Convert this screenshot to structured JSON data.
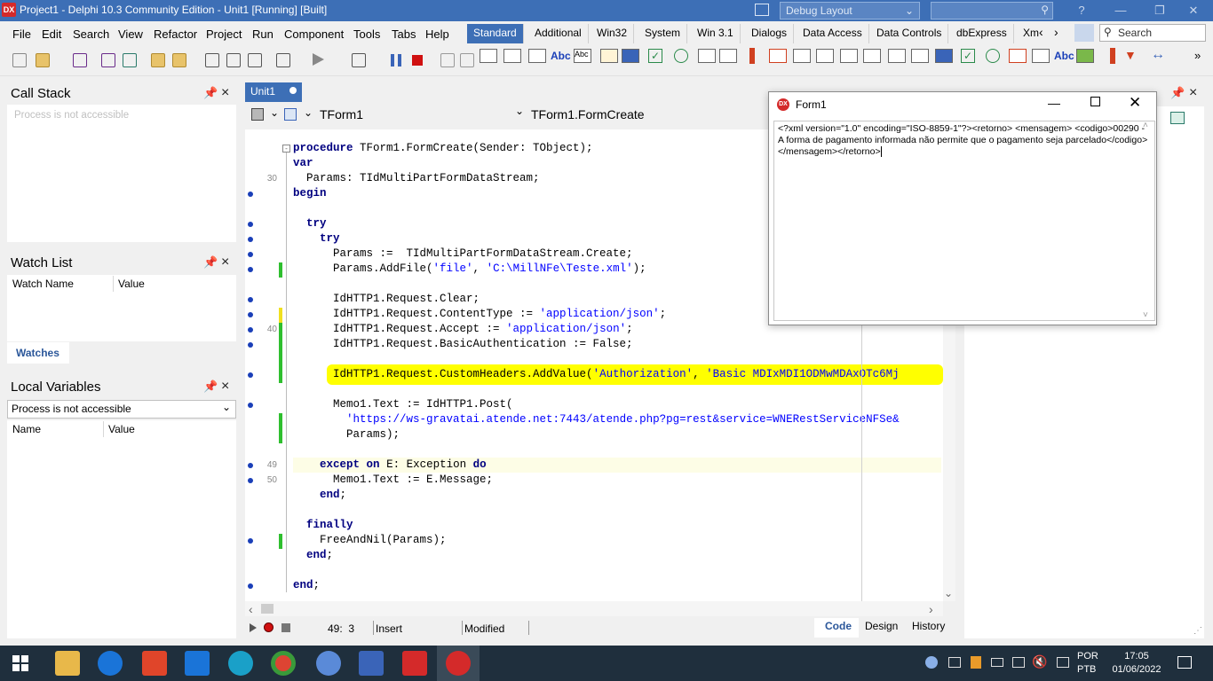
{
  "titlebar": {
    "logo": "DX",
    "title": "Project1 - Delphi 10.3 Community Edition - Unit1 [Running] [Built]",
    "layout_value": "Debug Layout"
  },
  "menu": [
    "File",
    "Edit",
    "Search",
    "View",
    "Refactor",
    "Project",
    "Run",
    "Component",
    "Tools",
    "Tabs",
    "Help"
  ],
  "palette_tabs": [
    "Standard",
    "Additional",
    "Win32",
    "System",
    "Win 3.1",
    "Dialogs",
    "Data Access",
    "Data Controls",
    "dbExpress",
    "Xm"
  ],
  "palette_search_placeholder": "Search",
  "call_stack": {
    "title": "Call Stack",
    "status": "Process is not accessible"
  },
  "watch_list": {
    "title": "Watch List",
    "col_name": "Watch Name",
    "col_value": "Value",
    "tab": "Watches"
  },
  "local_vars": {
    "title": "Local Variables",
    "combo": "Process is not accessible",
    "col_name": "Name",
    "col_value": "Value"
  },
  "editor": {
    "tab": "Unit1",
    "class_combo": "TForm1",
    "method_combo": "TForm1.FormCreate",
    "lines": [
      {
        "t": "procedure TForm1.FormCreate(Sender: TObject);",
        "ln": "",
        "bp": false
      },
      {
        "t": "var",
        "ln": "",
        "bp": false
      },
      {
        "t": "  Params: TIdMultiPartFormDataStream;",
        "ln": "30",
        "bp": false
      },
      {
        "t": "begin",
        "ln": "",
        "bp": true
      },
      {
        "t": "",
        "ln": "",
        "bp": false
      },
      {
        "t": "  try",
        "ln": "",
        "bp": true
      },
      {
        "t": "    try",
        "ln": "",
        "bp": true
      },
      {
        "t": "      Params :=  TIdMultiPartFormDataStream.Create;",
        "ln": "",
        "bp": true
      },
      {
        "t": "      Params.AddFile('file', 'C:\\MillNFe\\Teste.xml');",
        "ln": "",
        "bp": true
      },
      {
        "t": "",
        "ln": "",
        "bp": false
      },
      {
        "t": "      IdHTTP1.Request.Clear;",
        "ln": "",
        "bp": true
      },
      {
        "t": "      IdHTTP1.Request.ContentType := 'application/json';",
        "ln": "",
        "bp": true
      },
      {
        "t": "      IdHTTP1.Request.Accept := 'application/json';",
        "ln": "40",
        "bp": true
      },
      {
        "t": "      IdHTTP1.Request.BasicAuthentication := False;",
        "ln": "",
        "bp": true
      },
      {
        "t": "",
        "ln": "",
        "bp": false
      },
      {
        "t": "      IdHTTP1.Request.CustomHeaders.AddValue('Authorization', 'Basic MDIxMDI1ODMwMDAxOTc6Mj",
        "ln": "",
        "bp": true
      },
      {
        "t": "",
        "ln": "",
        "bp": false
      },
      {
        "t": "      Memo1.Text := IdHTTP1.Post(",
        "ln": "",
        "bp": true
      },
      {
        "t": "        'https://ws-gravatai.atende.net:7443/atende.php?pg=rest&service=WNERestServiceNFSe&",
        "ln": "",
        "bp": false
      },
      {
        "t": "        Params);",
        "ln": "",
        "bp": false
      },
      {
        "t": "",
        "ln": "",
        "bp": false
      },
      {
        "t": "    except on E: Exception do",
        "ln": "49",
        "bp": true
      },
      {
        "t": "      Memo1.Text := E.Message;",
        "ln": "50",
        "bp": true
      },
      {
        "t": "    end;",
        "ln": "",
        "bp": false
      },
      {
        "t": "",
        "ln": "",
        "bp": false
      },
      {
        "t": "  finally",
        "ln": "",
        "bp": false
      },
      {
        "t": "    FreeAndNil(Params);",
        "ln": "",
        "bp": true
      },
      {
        "t": "  end;",
        "ln": "",
        "bp": false
      },
      {
        "t": "",
        "ln": "",
        "bp": false
      },
      {
        "t": "end;",
        "ln": "",
        "bp": true
      }
    ]
  },
  "status": {
    "position": "49:  3",
    "mode": "Insert",
    "modified": "Modified",
    "tab_code": "Code",
    "tab_design": "Design",
    "tab_history": "History"
  },
  "form1": {
    "logo": "DX",
    "title": "Form1",
    "memo": "<?xml version=\"1.0\" encoding=\"ISO-8859-1\"?><retorno>  <mensagem>  <codigo>00290 - A forma de pagamento informada não permite que o pagamento seja parcelado</codigo>       </mensagem></retorno>"
  },
  "taskbar": {
    "lang1": "POR",
    "lang2": "PTB",
    "time": "17:05",
    "date": "01/06/2022"
  },
  "colors": {
    "accent": "#3d6fb6",
    "highlight": "#ffff00",
    "breakpoint": "#1a3fb8"
  }
}
